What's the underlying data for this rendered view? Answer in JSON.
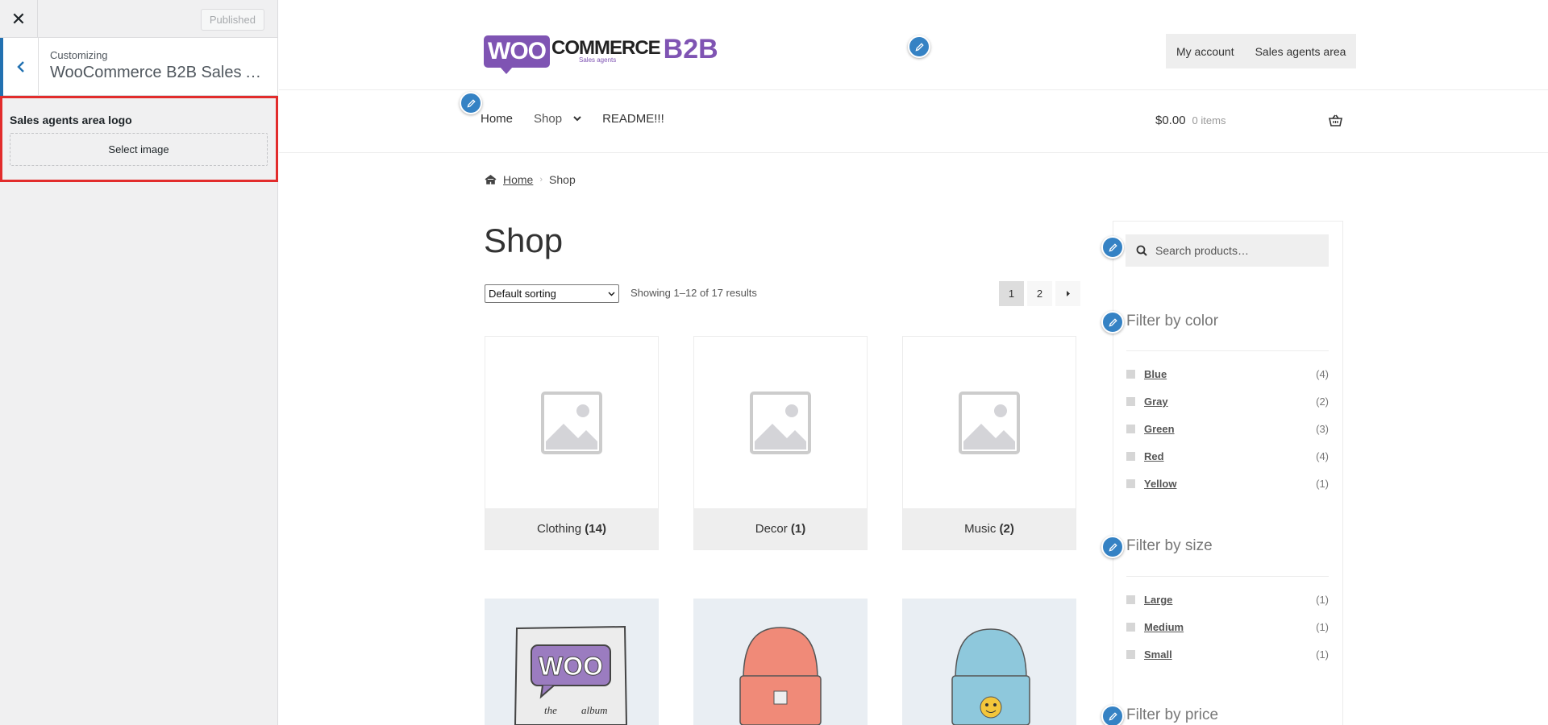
{
  "customizer": {
    "close_icon": "close-icon",
    "published_label": "Published",
    "customizing_label": "Customizing",
    "section_title": "WooCommerce B2B Sales Ag...",
    "control_label": "Sales agents area logo",
    "select_image_label": "Select image",
    "highlight_color": "#e22c2c",
    "accent_color": "#2271b1"
  },
  "site": {
    "logo": {
      "woo": "WOO",
      "commerce": "COMMERCE",
      "b2b": "B2B",
      "sub": "Sales agents"
    },
    "top_nav": [
      "My account",
      "Sales agents area"
    ],
    "main_nav": [
      {
        "label": "Home"
      },
      {
        "label": "Shop",
        "has_dropdown": true
      },
      {
        "label": "README!!!"
      }
    ],
    "cart": {
      "total": "$0.00",
      "items": "0 items",
      "icon": "basket-icon"
    },
    "breadcrumb": {
      "home": "Home",
      "current": "Shop"
    },
    "page_title": "Shop",
    "sorting": {
      "selected": "Default sorting"
    },
    "result_count": "Showing 1–12 of 17 results",
    "pagination": [
      "1",
      "2"
    ],
    "categories": [
      {
        "name": "Clothing",
        "count": "(14)"
      },
      {
        "name": "Decor",
        "count": "(1)"
      },
      {
        "name": "Music",
        "count": "(2)"
      }
    ],
    "second_row": {
      "album_text_1": "WOO",
      "album_text_2": "the",
      "album_text_3": "album"
    },
    "search_placeholder": "Search products…",
    "filter_color": {
      "title": "Filter by color",
      "items": [
        {
          "name": "Blue",
          "count": "(4)"
        },
        {
          "name": "Gray",
          "count": "(2)"
        },
        {
          "name": "Green",
          "count": "(3)"
        },
        {
          "name": "Red",
          "count": "(4)"
        },
        {
          "name": "Yellow",
          "count": "(1)"
        }
      ]
    },
    "filter_size": {
      "title": "Filter by size",
      "items": [
        {
          "name": "Large",
          "count": "(1)"
        },
        {
          "name": "Medium",
          "count": "(1)"
        },
        {
          "name": "Small",
          "count": "(1)"
        }
      ]
    },
    "filter_price": {
      "title": "Filter by price"
    },
    "brand_color": "#7f54b3",
    "edit_shortcut_color": "#3582c4"
  }
}
